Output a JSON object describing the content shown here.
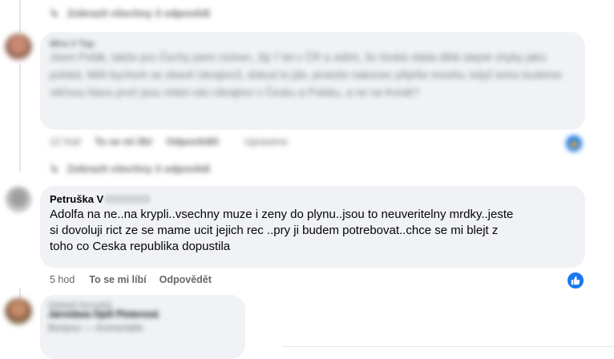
{
  "colors": {
    "bubble": "#f0f2f5",
    "secondary_text": "#65676b",
    "like_blue": "#1877f2"
  },
  "thread1": {
    "see_more": "Zobrazit všechny 3 odpovědi"
  },
  "comment_blurred": {
    "author": "Míra V Top",
    "text": "Jsem Polák, takže pro Čechy jsem cizinec, žiji 7 let v ČR a vidím, že česká vláda dělá stejné chyby jako polská. Měli bychom se zbavit Ukrajinců, dokud to jde, protože nakonec připíše mnoho, když tomu budeme věčnou hlavu proč jsou vítáni vás Ukrajinci v Česku a Polsku, a ne na frontě?",
    "time": "12 hod",
    "like": "To se mi líbí",
    "reply": "Odpovědět",
    "translate": "Upraveno"
  },
  "thread2": {
    "see_more": "Zobrazit všechny 3 odpovědi"
  },
  "comment_main": {
    "author": "Petruška V",
    "text_lines": [
      "Adolfa na ne..na krypli..vsechny muze i zeny do plynu..jsou to neuveritelny mrdky..jeste",
      "si dovoluji rict ze se mame ucit jejich rec ..pry ji budem potrebovat..chce se mi blejt z",
      "toho co Ceska republika dopustila"
    ],
    "time": "5 hod",
    "like": "To se mi líbí",
    "reply": "Odpovědět"
  },
  "comment_bottom": {
    "meta": "Nejlepší fanoušek",
    "author": "Jaroslava Opiš Pinterová",
    "text": "Bonjour — Komentáře"
  }
}
